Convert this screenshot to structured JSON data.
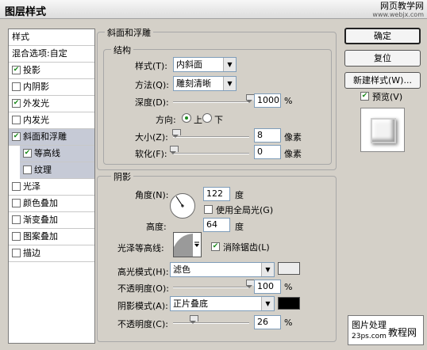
{
  "window": {
    "title": "图层样式"
  },
  "watermark_top": {
    "line1": "网页教学网",
    "line2": "www.webjx.com"
  },
  "left_list": {
    "items": [
      {
        "label": "样式",
        "type": "header"
      },
      {
        "label": "混合选项:自定",
        "type": "header"
      },
      {
        "label": "投影",
        "checked": true
      },
      {
        "label": "内阴影",
        "checked": false
      },
      {
        "label": "外发光",
        "checked": true
      },
      {
        "label": "内发光",
        "checked": false
      },
      {
        "label": "斜面和浮雕",
        "checked": true,
        "selected": true
      },
      {
        "label": "等高线",
        "checked": true,
        "sub": true
      },
      {
        "label": "纹理",
        "checked": false,
        "sub": true
      },
      {
        "label": "光泽",
        "checked": false
      },
      {
        "label": "颜色叠加",
        "checked": false
      },
      {
        "label": "渐变叠加",
        "checked": false
      },
      {
        "label": "图案叠加",
        "checked": false
      },
      {
        "label": "描边",
        "checked": false
      }
    ]
  },
  "bevel": {
    "group_title": "斜面和浮雕",
    "structure_title": "结构",
    "style_label": "样式(T):",
    "style_value": "内斜面",
    "technique_label": "方法(Q):",
    "technique_value": "雕刻清晰",
    "depth_label": "深度(D):",
    "depth_value": "1000",
    "depth_unit": "%",
    "depth_fraction": 1.0,
    "direction_label": "方向:",
    "direction_up": "上",
    "direction_down": "下",
    "size_label": "大小(Z):",
    "size_value": "8",
    "size_unit": "像素",
    "size_fraction": 0.03,
    "soften_label": "软化(F):",
    "soften_value": "0",
    "soften_unit": "像素",
    "soften_fraction": 0.0
  },
  "shading": {
    "title": "阴影",
    "angle_label": "角度(N):",
    "angle_value": "122",
    "angle_unit": "度",
    "global_light_label": "使用全局光(G)",
    "altitude_label": "高度:",
    "altitude_value": "64",
    "altitude_unit": "度",
    "gloss_label": "光泽等高线:",
    "antialias_label": "消除锯齿(L)",
    "highlight_label": "高光模式(H):",
    "highlight_value": "滤色",
    "highlight_color": "#ececec",
    "hl_opacity_label": "不透明度(O):",
    "hl_opacity_value": "100",
    "hl_opacity_fraction": 1.0,
    "shadow_label": "阴影模式(A):",
    "shadow_value": "正片叠底",
    "shadow_color": "#000000",
    "sh_opacity_label": "不透明度(C):",
    "sh_opacity_value": "26",
    "sh_opacity_fraction": 0.26,
    "percent": "%"
  },
  "buttons": {
    "ok": "确定",
    "cancel": "复位",
    "new_style": "新建样式(W)...",
    "preview": "预览(V)"
  },
  "watermark_bottom": {
    "line1": "图片处理",
    "line2": "23ps.com",
    "line3": "教程网"
  }
}
